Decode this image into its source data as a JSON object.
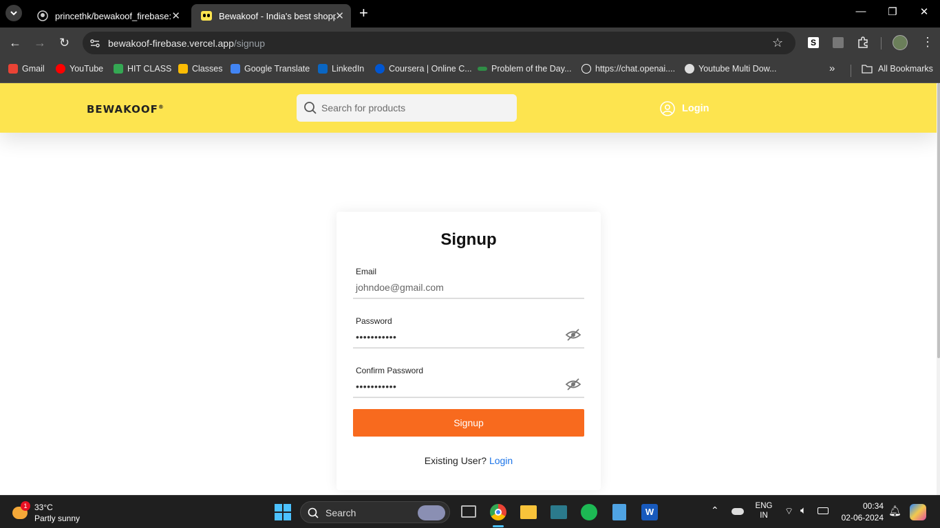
{
  "browser": {
    "tabs": [
      {
        "title": "princethk/bewakoof_firebase: B"
      },
      {
        "title": "Bewakoof - India's best shoppin"
      }
    ],
    "new_tab": "+",
    "url_host": "bewakoof-firebase.vercel.app",
    "url_path": "/signup"
  },
  "bookmarks": [
    {
      "label": "Gmail",
      "color": "#ea4335"
    },
    {
      "label": "YouTube",
      "color": "#ff0000"
    },
    {
      "label": "HIT CLASS",
      "color": "#34a853"
    },
    {
      "label": "Classes",
      "color": "#fbbc04"
    },
    {
      "label": "Google Translate",
      "color": "#4285f4"
    },
    {
      "label": "LinkedIn",
      "color": "#0a66c2"
    },
    {
      "label": "Coursera | Online C...",
      "color": "#0056d2"
    },
    {
      "label": "Problem of the Day...",
      "color": "#2f8d46"
    },
    {
      "label": "https://chat.openai....",
      "color": "#ffffff"
    },
    {
      "label": "Youtube Multi Dow...",
      "color": "#ffffff"
    }
  ],
  "all_bookmarks": "All Bookmarks",
  "site": {
    "logo": "Bewakoof",
    "logo_mark": "®",
    "search_placeholder": "Search for products",
    "login": "Login",
    "brand_color": "#fde44f",
    "accent_color": "#f86a1e"
  },
  "signup_form": {
    "title": "Signup",
    "email_label": "Email",
    "email_value": "johndoe@gmail.com",
    "password_label": "Password",
    "password_value": "•••••••••••",
    "confirm_label": "Confirm Password",
    "confirm_value": "•••••••••••",
    "submit_label": "Signup",
    "existing_text": "Existing User?",
    "login_link": "Login"
  },
  "taskbar": {
    "weather_temp": "33°C",
    "weather_desc": "Partly sunny",
    "weather_badge": "1",
    "search": "Search",
    "lang_top": "ENG",
    "lang_bottom": "IN",
    "time": "00:34",
    "date": "02-06-2024"
  }
}
